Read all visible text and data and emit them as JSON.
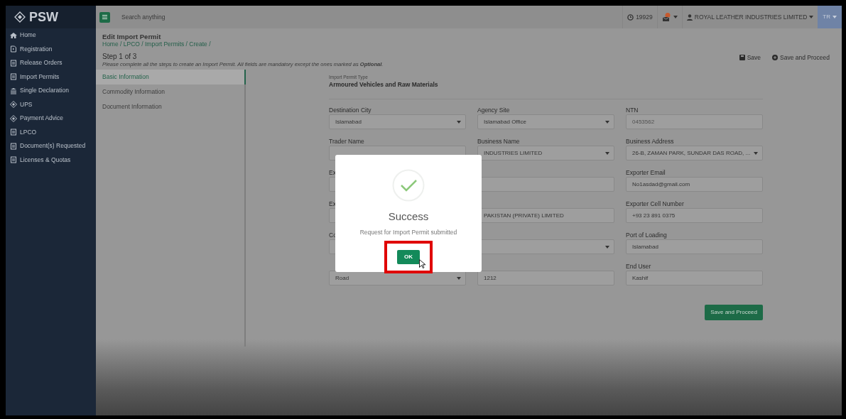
{
  "logo": {
    "text": "PSW"
  },
  "sidebar": {
    "items": [
      {
        "label": "Home"
      },
      {
        "label": "Registration"
      },
      {
        "label": "Release Orders"
      },
      {
        "label": "Import Permits"
      },
      {
        "label": "Single Declaration"
      },
      {
        "label": "UPS"
      },
      {
        "label": "Payment Advice"
      },
      {
        "label": "LPCO"
      },
      {
        "label": "Document(s) Requested"
      },
      {
        "label": "Licenses & Quotas"
      }
    ]
  },
  "topbar": {
    "search": {
      "placeholder": "Search anything"
    },
    "counter": "19929",
    "user": "ROYAL LEATHER INDUSTRIES LIMITED",
    "initials": "TR"
  },
  "page": {
    "title": "Edit Import Permit",
    "breadcrumbs": "Home / LPCO / Import Permits / Create /",
    "step": "Step 1 of 3",
    "instructions": "Please complete all the steps to create an Import Permit. All fields are mandatory except the ones marked as **Optional**.",
    "actions": [
      "Save",
      "Save and Proceed"
    ]
  },
  "steps": [
    {
      "label": "Basic Information",
      "selected": true
    },
    {
      "label": "Commodity Information",
      "selected": false
    },
    {
      "label": "Document Information",
      "selected": false
    }
  ],
  "form": {
    "permit_type_label": "Import Permit Type",
    "permit_type": "Armoured Vehicles and Raw Materials",
    "rows": [
      [
        {
          "label": "Destination City",
          "kind": "select",
          "value": "Islamabad"
        },
        {
          "label": "Agency Site",
          "kind": "select",
          "value": "Islamabad Office"
        },
        {
          "label": "NTN",
          "kind": "readonly",
          "value": "0453562"
        }
      ],
      [
        {
          "label": "Trader Name",
          "kind": "text"
        },
        {
          "label": "Business Name",
          "kind": "select",
          "value": "INDUSTRIES LIMITED"
        },
        {
          "label": "Business Address",
          "kind": "select",
          "value": "26-B, ZAMAN PARK, SUNDAR DAS ROAD, ..."
        }
      ],
      [
        {
          "label": "Ex",
          "kind": "text"
        },
        {
          "kind": "text"
        },
        {
          "label": "Exporter Email",
          "kind": "text",
          "value": "No1asdad@gmail.com"
        }
      ],
      [
        {
          "label": "Ex",
          "kind": "text"
        },
        {
          "kind": "text",
          "value": "PAKISTAN (PRIVATE) LIMITED"
        },
        {
          "label": "Exporter Cell Number",
          "kind": "text",
          "value": "+93 23 891 0375"
        }
      ],
      [
        {
          "label": "Co",
          "kind": "text"
        },
        {
          "kind": "select"
        },
        {
          "label": "Port of Loading",
          "kind": "text",
          "value": "Islamabad"
        }
      ],
      [
        {
          "kind": "select",
          "value": "Road"
        },
        {
          "kind": "text",
          "value": "1212"
        },
        {
          "label": "End User",
          "kind": "text",
          "value": "Kashif"
        }
      ]
    ],
    "submit": "Save and Proceed"
  },
  "modal": {
    "title": "Success",
    "message": "Request for Import Permit submitted",
    "button": "OK",
    "highlighted": true
  }
}
